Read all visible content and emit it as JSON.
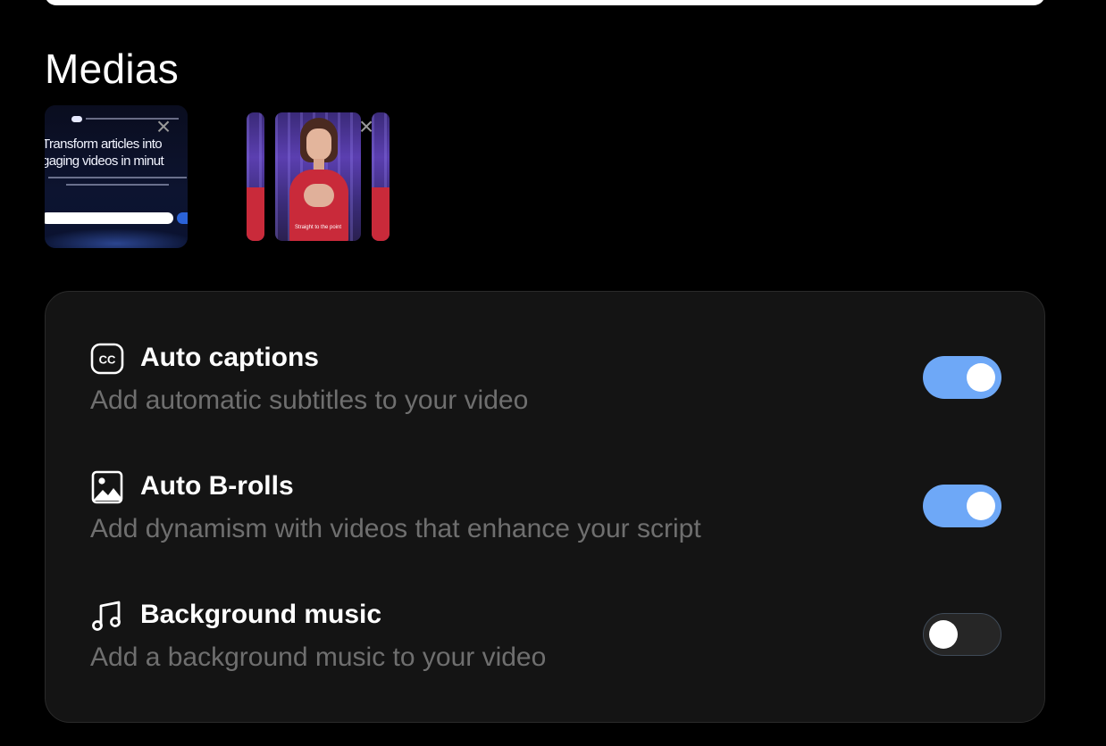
{
  "medias": {
    "title": "Medias",
    "items": [
      {
        "type": "article-preview",
        "headline_line1": "Transform articles into",
        "headline_line2": "gaging videos in minut",
        "close_label": "×"
      },
      {
        "type": "video-preview",
        "caption": "Straight to the point",
        "close_label": "×"
      }
    ]
  },
  "settings": [
    {
      "icon": "closed-captions-icon",
      "title": "Auto captions",
      "description": "Add automatic subtitles to your video",
      "enabled": true
    },
    {
      "icon": "image-icon",
      "title": "Auto B-rolls",
      "description": "Add dynamism with videos that enhance your script",
      "enabled": true
    },
    {
      "icon": "music-note-icon",
      "title": "Background music",
      "description": "Add a background music to your video",
      "enabled": false
    }
  ],
  "colors": {
    "toggle_on": "#6ea8f7",
    "toggle_off": "#262626",
    "card_bg": "#141414",
    "desc_text": "#6f6f6f"
  }
}
